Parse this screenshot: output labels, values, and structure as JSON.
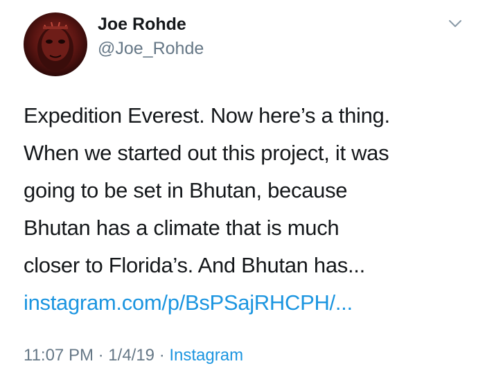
{
  "author": {
    "name": "Joe Rohde",
    "handle": "@Joe_Rohde"
  },
  "tweet": {
    "lines": [
      "Expedition Everest. Now here’s a thing.",
      "When we started out this project, it was",
      "going to be set in Bhutan, because",
      "Bhutan has a climate that is much",
      "closer to Florida’s. And Bhutan has..."
    ],
    "link": "instagram.com/p/BsPSajRHCPH/..."
  },
  "meta": {
    "time": "11:07 PM",
    "separator1": "·",
    "date": "1/4/19",
    "separator2": "·",
    "source": "Instagram"
  },
  "icons": {
    "menu": "chevron-down-icon"
  },
  "colors": {
    "text": "#14171a",
    "secondary": "#657786",
    "link": "#1b95e0"
  }
}
